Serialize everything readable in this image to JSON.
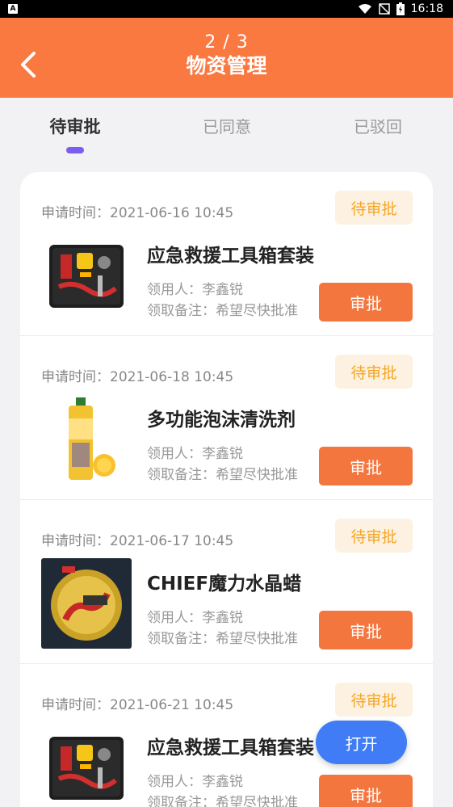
{
  "status_bar": {
    "notification_icon": "A",
    "time": "16:18"
  },
  "header": {
    "page_indicator": "2 / 3",
    "title": "物资管理"
  },
  "tabs": [
    {
      "label": "待审批",
      "active": true
    },
    {
      "label": "已同意",
      "active": false
    },
    {
      "label": "已驳回",
      "active": false
    }
  ],
  "items": [
    {
      "apply_time": "申请时间：2021-06-16 10:45",
      "status": "待审批",
      "name": "应急救援工具箱套装",
      "recipient": "领用人：李鑫锐",
      "note": "领取备注：希望尽快批准",
      "button": "审批",
      "image": "toolbox-image"
    },
    {
      "apply_time": "申请时间：2021-06-18 10:45",
      "status": "待审批",
      "name": "多功能泡沫清洗剂",
      "recipient": "领用人：李鑫锐",
      "note": "领取备注：希望尽快批准",
      "button": "审批",
      "image": "foam-cleaner-image"
    },
    {
      "apply_time": "申请时间：2021-06-17 10:45",
      "status": "待审批",
      "name": "CHIEF魔力水晶蜡",
      "recipient": "领用人：李鑫锐",
      "note": "领取备注：希望尽快批准",
      "button": "审批",
      "image": "crystal-wax-image"
    },
    {
      "apply_time": "申请时间：2021-06-21 10:45",
      "status": "待审批",
      "name": "应急救援工具箱套装",
      "recipient": "领用人：李鑫锐",
      "note": "领取备注：希望尽快批准",
      "button": "审批",
      "image": "toolbox-image"
    }
  ],
  "fab": {
    "label": "打开"
  },
  "colors": {
    "header": "#fa7940",
    "tab_indicator": "#7d5cf0",
    "status_text": "#f5a623",
    "status_bg": "#fdf1e1",
    "approve_button": "#f4763f",
    "fab": "#3f7cf5"
  }
}
